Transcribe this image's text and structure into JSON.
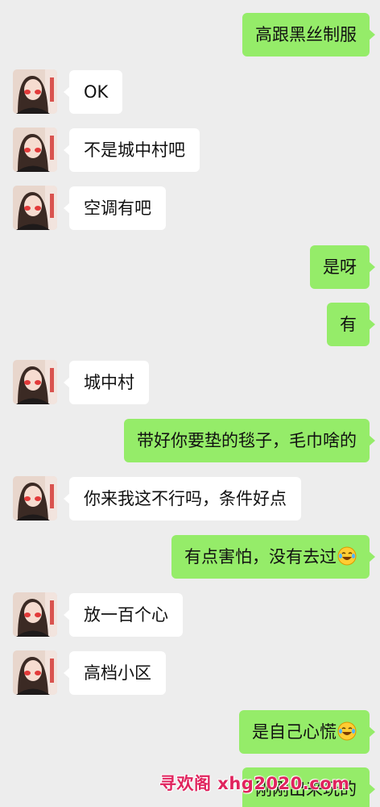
{
  "messages": [
    {
      "side": "out",
      "text": "高跟黑丝制服"
    },
    {
      "side": "in",
      "text": "OK"
    },
    {
      "side": "in",
      "text": "不是城中村吧"
    },
    {
      "side": "in",
      "text": "空调有吧"
    },
    {
      "side": "out",
      "text": "是呀"
    },
    {
      "side": "out",
      "text": "有"
    },
    {
      "side": "in",
      "text": "城中村"
    },
    {
      "side": "out",
      "text": "带好你要垫的毯子，毛巾啥的"
    },
    {
      "side": "in",
      "text": "你来我这不行吗，条件好点"
    },
    {
      "side": "out",
      "text": "有点害怕，没有去过",
      "emoji": "crying-laughing-emoji-icon"
    },
    {
      "side": "in",
      "text": "放一百个心"
    },
    {
      "side": "in",
      "text": "高档小区"
    },
    {
      "side": "out",
      "text": "是自己心慌",
      "emoji": "crying-laughing-emoji-icon"
    },
    {
      "side": "out",
      "text": "刚刚出来玩的"
    }
  ],
  "watermark": "寻欢阁 xhg2020.com",
  "colors": {
    "background": "#ededed",
    "incoming_bubble": "#ffffff",
    "outgoing_bubble": "#95ec69",
    "watermark": "#e0245e"
  }
}
